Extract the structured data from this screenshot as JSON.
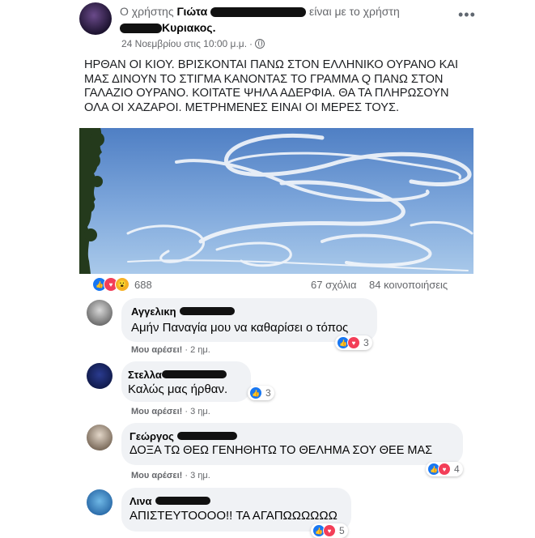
{
  "post": {
    "prefix": "Ο χρήστης",
    "author": "Γιώτα",
    "with_text": "είναι με το χρήστη",
    "tagged_user": "Κυριακος.",
    "date": "24 Νοεμβρίου στις 10:00 μ.μ.",
    "audience_icon": "globe-icon",
    "separator": "·",
    "text": "ΗΡΘΑΝ ΟΙ ΚΙΟΥ. ΒΡΙΣΚΟΝΤΑΙ ΠΑΝΩ ΣΤΟΝ ΕΛΛΗΝΙΚΟ ΟΥΡΑΝΟ ΚΑΙ ΜΑΣ ΔΙΝΟΥΝ ΤΟ ΣΤΙΓΜΑ ΚΑΝΟΝΤΑΣ ΤΟ ΓΡΑΜΜΑ Q ΠΑΝΩ ΣΤΟΝ ΓΑΛΑΖΙΟ ΟΥΡΑΝΟ. ΚΟΙΤΑΤΕ ΨΗΛΑ ΑΔΕΡΦΙΑ. ΘΑ ΤΑ ΠΛΗΡΩΣΟΥΝ ΟΛΑ ΟΙ ΧΑΖΑΡΟΙ. ΜΕΤΡΗΜΕΝΕΣ ΕΙΝΑΙ ΟΙ ΜΕΡΕΣ ΤΟΥΣ.",
    "reaction_count": "688",
    "comments_count": "67 σχόλια",
    "shares_count": "84 κοινοποιήσεις",
    "menu_icon": "more-dots-icon"
  },
  "comments": [
    {
      "name": "Αγγελικη",
      "text": "Αμήν Παναγία μου να καθαρίσει ο τόπος",
      "like_label": "Μου αρέσει!",
      "sep": "·",
      "time": "2 ημ.",
      "reactions": "3"
    },
    {
      "name": "Στελλα",
      "text": "Καλώς μας ήρθαν.",
      "like_label": "Μου αρέσει!",
      "sep": "·",
      "time": "3 ημ.",
      "reactions": "3"
    },
    {
      "name": "Γεώργος",
      "text": "ΔΟΞΑ ΤΩ ΘΕΩ ΓΕΝΗΘΗΤΩ ΤΟ ΘΕΛΗΜΑ ΣΟΥ ΘΕΕ ΜΑΣ",
      "like_label": "Μου αρέσει!",
      "sep": "·",
      "time": "3 ημ.",
      "reactions": "4"
    },
    {
      "name": "Λινα",
      "text": "ΑΠΙΣΤΕΥΤΟΟΟΟ!! ΤΑ ΑΓΑΠΩΩΩΩΩΩ",
      "reactions": "5"
    }
  ],
  "colors": {
    "sky_top": "#4f7fc4",
    "sky_bottom": "#9cc0e6",
    "like_blue": "#1877f2",
    "love_red": "#f33e58",
    "wow_yellow": "#f7b125"
  }
}
